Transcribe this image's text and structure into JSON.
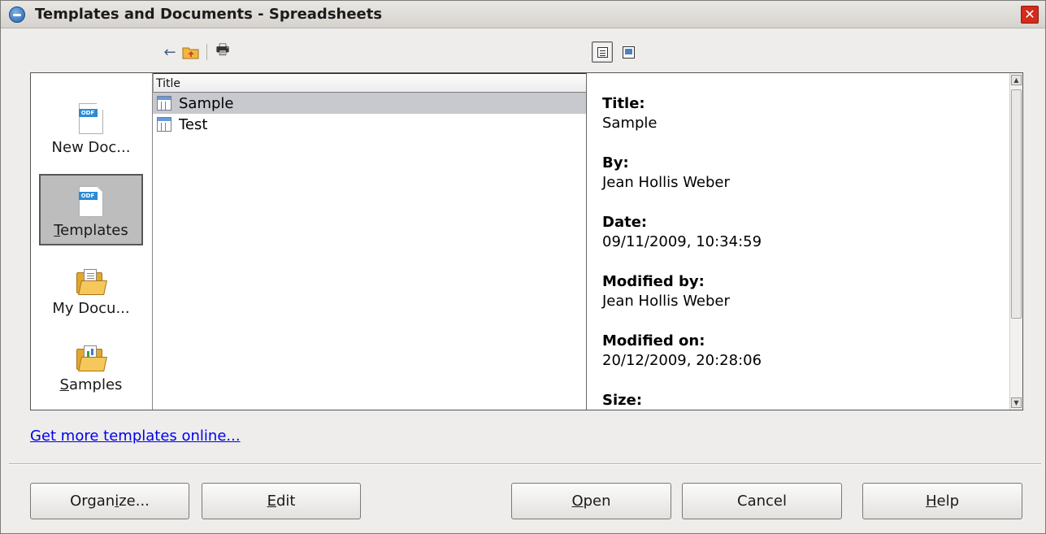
{
  "window": {
    "title": "Templates and Documents - Spreadsheets",
    "close_glyph": "✕"
  },
  "toolbar": {
    "back_icon": "←",
    "up_icon": "up-folder-icon",
    "print_icon": "🖶"
  },
  "sidebar": {
    "items": [
      {
        "label": "New Doc...",
        "icon": "odf-document-icon",
        "underline_char": ""
      },
      {
        "label_pre": "",
        "label_ul": "T",
        "label_post": "emplates",
        "icon": "odf-template-icon"
      },
      {
        "label": "My Docu...",
        "icon": "folder-documents-icon"
      },
      {
        "label_pre": "",
        "label_ul": "S",
        "label_post": "amples",
        "icon": "folder-samples-icon"
      }
    ]
  },
  "list": {
    "header": "Title",
    "rows": [
      {
        "title": "Sample"
      },
      {
        "title": "Test"
      }
    ]
  },
  "preview": {
    "fields": [
      {
        "label": "Title:",
        "value": "Sample"
      },
      {
        "label": "By:",
        "value": "Jean Hollis Weber"
      },
      {
        "label": "Date:",
        "value": "09/11/2009, 10:34:59"
      },
      {
        "label": "Modified by:",
        "value": "Jean Hollis Weber"
      },
      {
        "label": "Modified on:",
        "value": "20/12/2009, 20:28:06"
      },
      {
        "label": "Size:",
        "value": ""
      }
    ]
  },
  "link": {
    "text": "Get more templates online..."
  },
  "buttons": {
    "organize": {
      "pre": "Organ",
      "ul": "i",
      "post": "ze..."
    },
    "edit": {
      "pre": "",
      "ul": "E",
      "post": "dit"
    },
    "open": {
      "pre": "",
      "ul": "O",
      "post": "pen"
    },
    "cancel": {
      "pre": "Cancel",
      "ul": "",
      "post": ""
    },
    "help": {
      "pre": "",
      "ul": "H",
      "post": "elp"
    }
  }
}
